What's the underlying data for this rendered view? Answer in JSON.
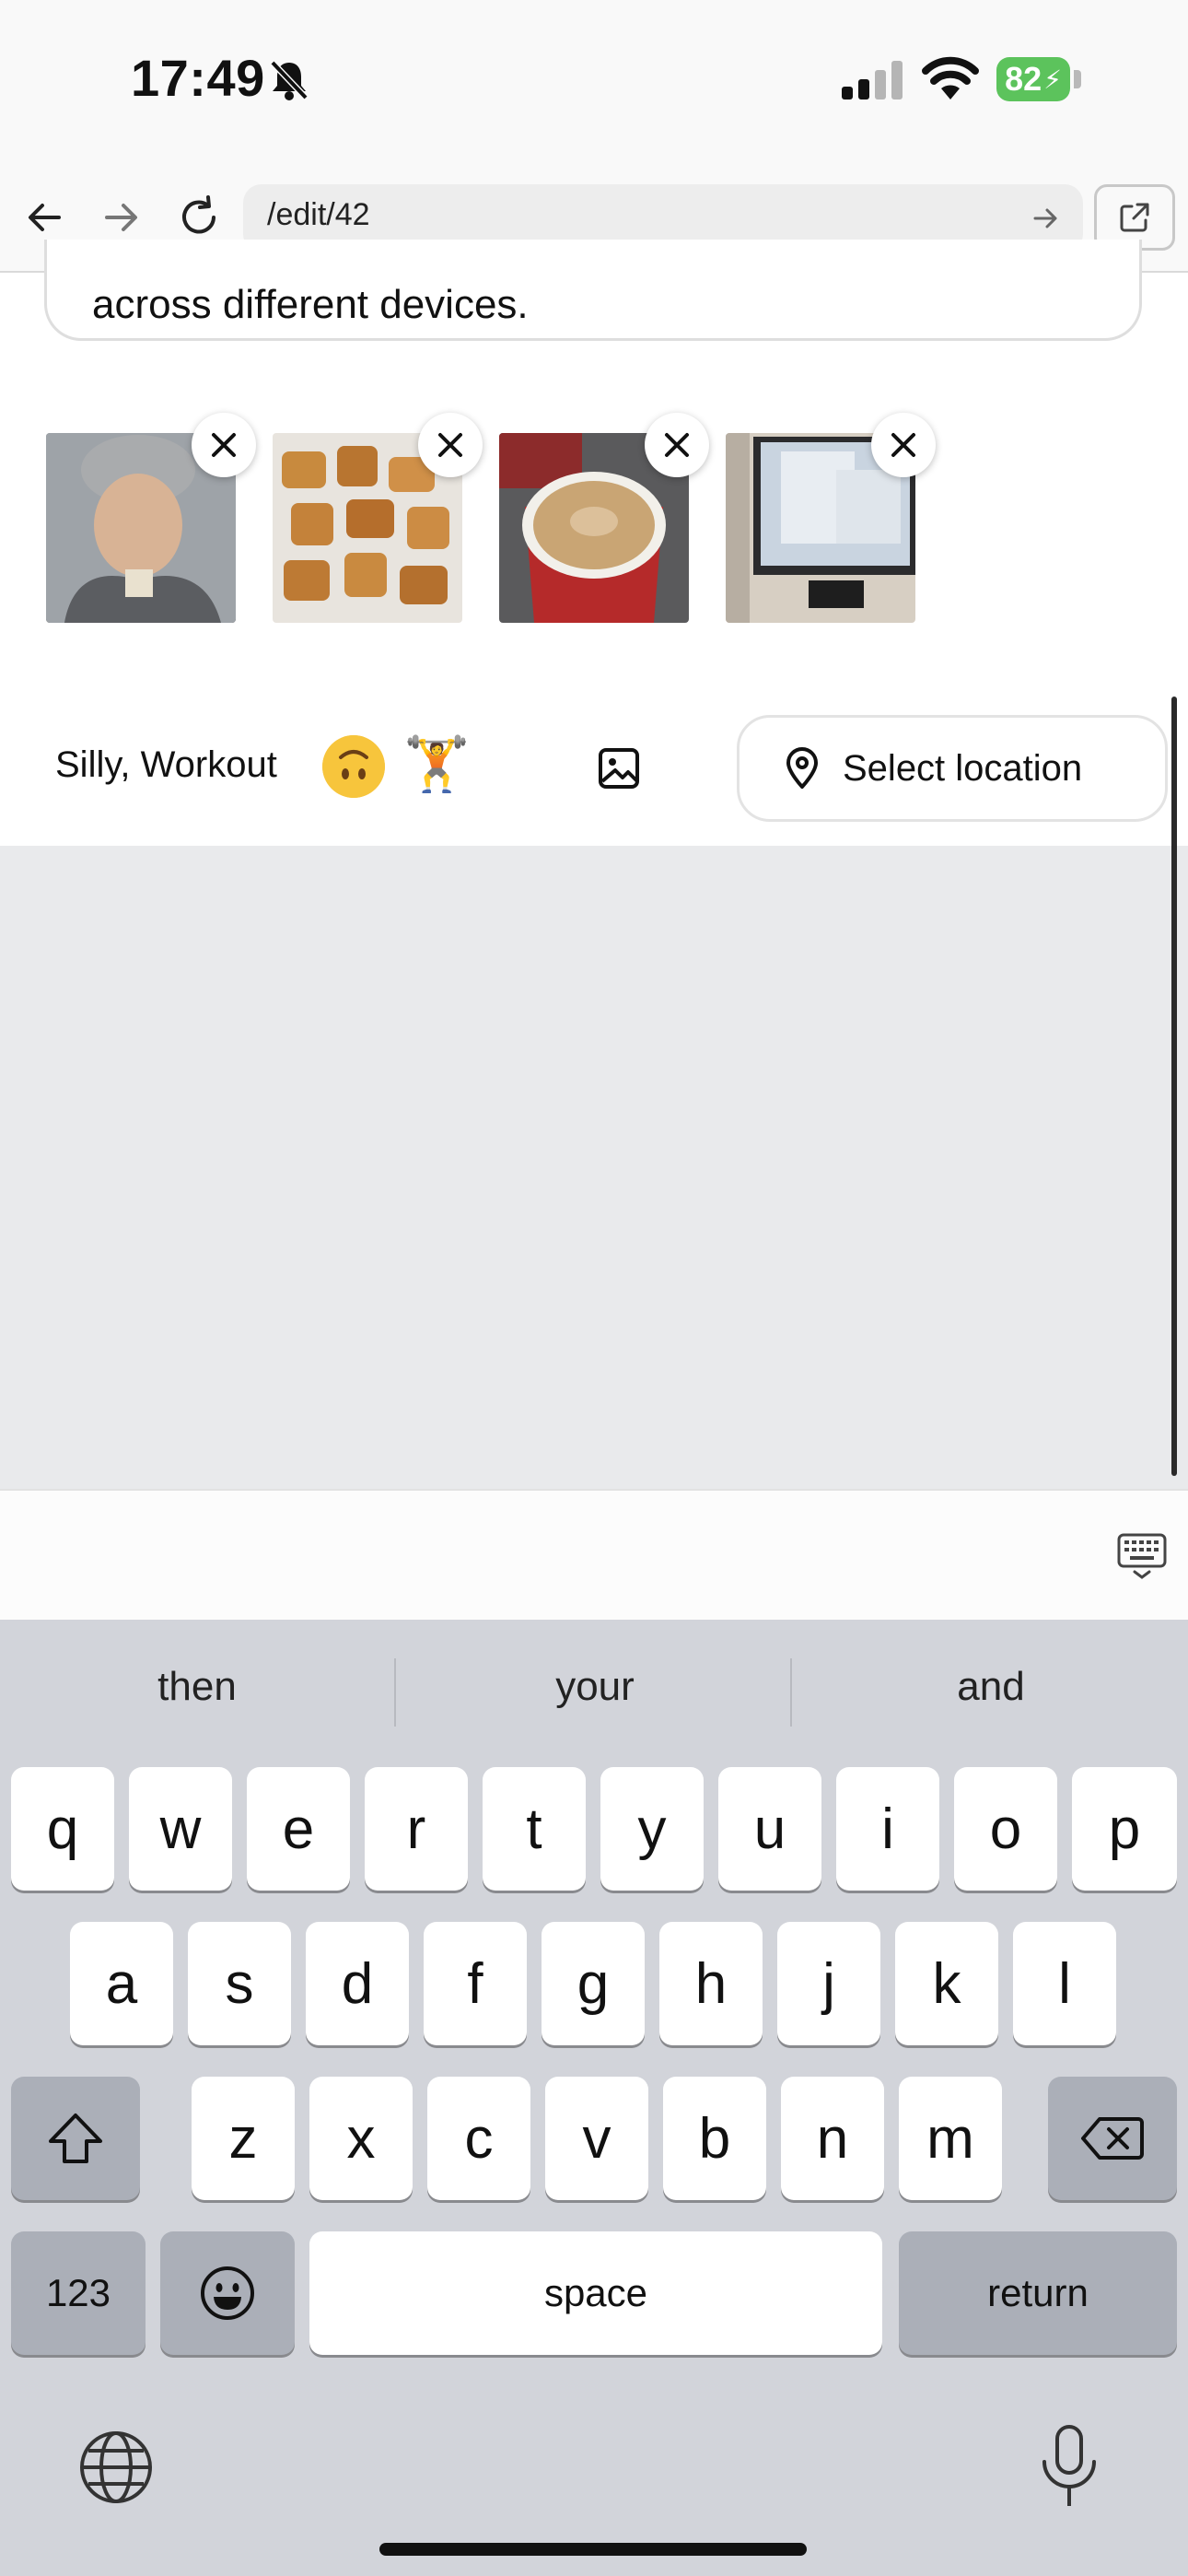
{
  "status_bar": {
    "time": "17:49",
    "battery": "82"
  },
  "browser": {
    "url": "/edit/42"
  },
  "editor": {
    "text_tail": "across different devices.",
    "attachments": [
      {
        "icon": "selfie-photo"
      },
      {
        "icon": "food-photo"
      },
      {
        "icon": "coffee-photo"
      },
      {
        "icon": "computer-screen-photo"
      }
    ],
    "tags": "Silly, Workout",
    "mood_emoji": "upside-down-face",
    "activity_emoji": "🏋",
    "location_label": "Select location"
  },
  "keyboard": {
    "suggestions": [
      "then",
      "your",
      "and"
    ],
    "row1": [
      "q",
      "w",
      "e",
      "r",
      "t",
      "y",
      "u",
      "i",
      "o",
      "p"
    ],
    "row2": [
      "a",
      "s",
      "d",
      "f",
      "g",
      "h",
      "j",
      "k",
      "l"
    ],
    "row3": [
      "z",
      "x",
      "c",
      "v",
      "b",
      "n",
      "m"
    ],
    "numbers_label": "123",
    "space_label": "space",
    "return_label": "return"
  }
}
